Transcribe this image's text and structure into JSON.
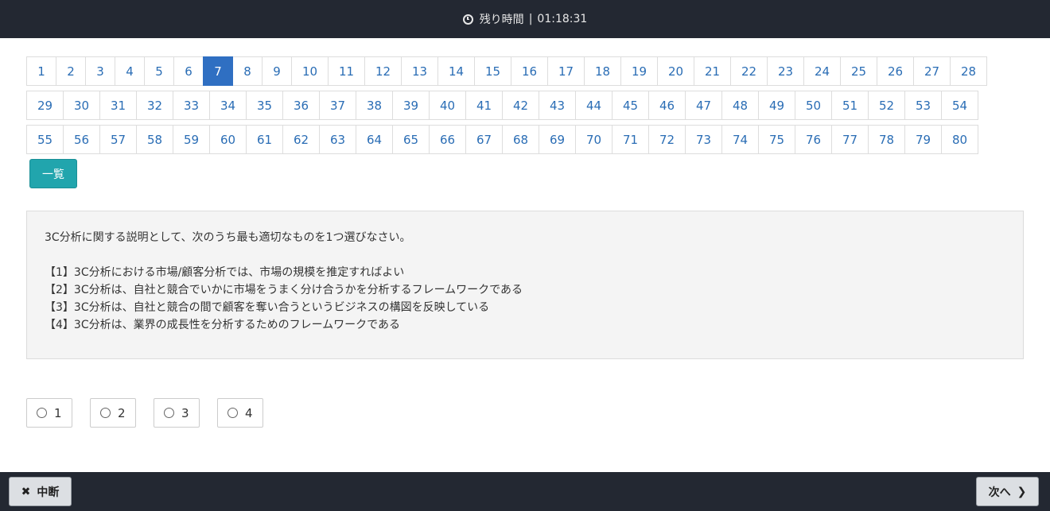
{
  "header": {
    "timer_label": "残り時間",
    "separator": "|",
    "timer_value": "01:18:31",
    "clock_icon": "clock-icon"
  },
  "pager": {
    "current": 7,
    "rows": [
      [
        "1",
        "2",
        "3",
        "4",
        "5",
        "6",
        "7",
        "8",
        "9",
        "10",
        "11",
        "12",
        "13",
        "14",
        "15",
        "16",
        "17",
        "18",
        "19",
        "20",
        "21",
        "22",
        "23",
        "24",
        "25",
        "26",
        "27",
        "28"
      ],
      [
        "29",
        "30",
        "31",
        "32",
        "33",
        "34",
        "35",
        "36",
        "37",
        "38",
        "39",
        "40",
        "41",
        "42",
        "43",
        "44",
        "45",
        "46",
        "47",
        "48",
        "49",
        "50",
        "51",
        "52",
        "53",
        "54"
      ],
      [
        "55",
        "56",
        "57",
        "58",
        "59",
        "60",
        "61",
        "62",
        "63",
        "64",
        "65",
        "66",
        "67",
        "68",
        "69",
        "70",
        "71",
        "72",
        "73",
        "74",
        "75",
        "76",
        "77",
        "78",
        "79",
        "80"
      ]
    ]
  },
  "list_button": {
    "label": "一覧"
  },
  "question": {
    "stem": "3C分析に関する説明として、次のうち最も適切なものを1つ選びなさい。",
    "options": [
      "【1】3C分析における市場/顧客分析では、市場の規模を推定すればよい",
      "【2】3C分析は、自社と競合でいかに市場をうまく分け合うかを分析するフレームワークである",
      "【3】3C分析は、自社と競合の間で顧客を奪い合うというビジネスの構図を反映している",
      "【4】3C分析は、業界の成長性を分析するためのフレームワークである"
    ]
  },
  "answer_choices": [
    "1",
    "2",
    "3",
    "4"
  ],
  "footer": {
    "pause_label": "中断",
    "pause_icon": "close-icon",
    "next_label": "次へ",
    "next_icon": "chevron-right-icon"
  },
  "colors": {
    "bar_bg": "#232832",
    "active_page": "#2f6fc2",
    "link": "#2a6db5",
    "list_button": "#21a5ad",
    "question_bg": "#f4f4f4"
  }
}
